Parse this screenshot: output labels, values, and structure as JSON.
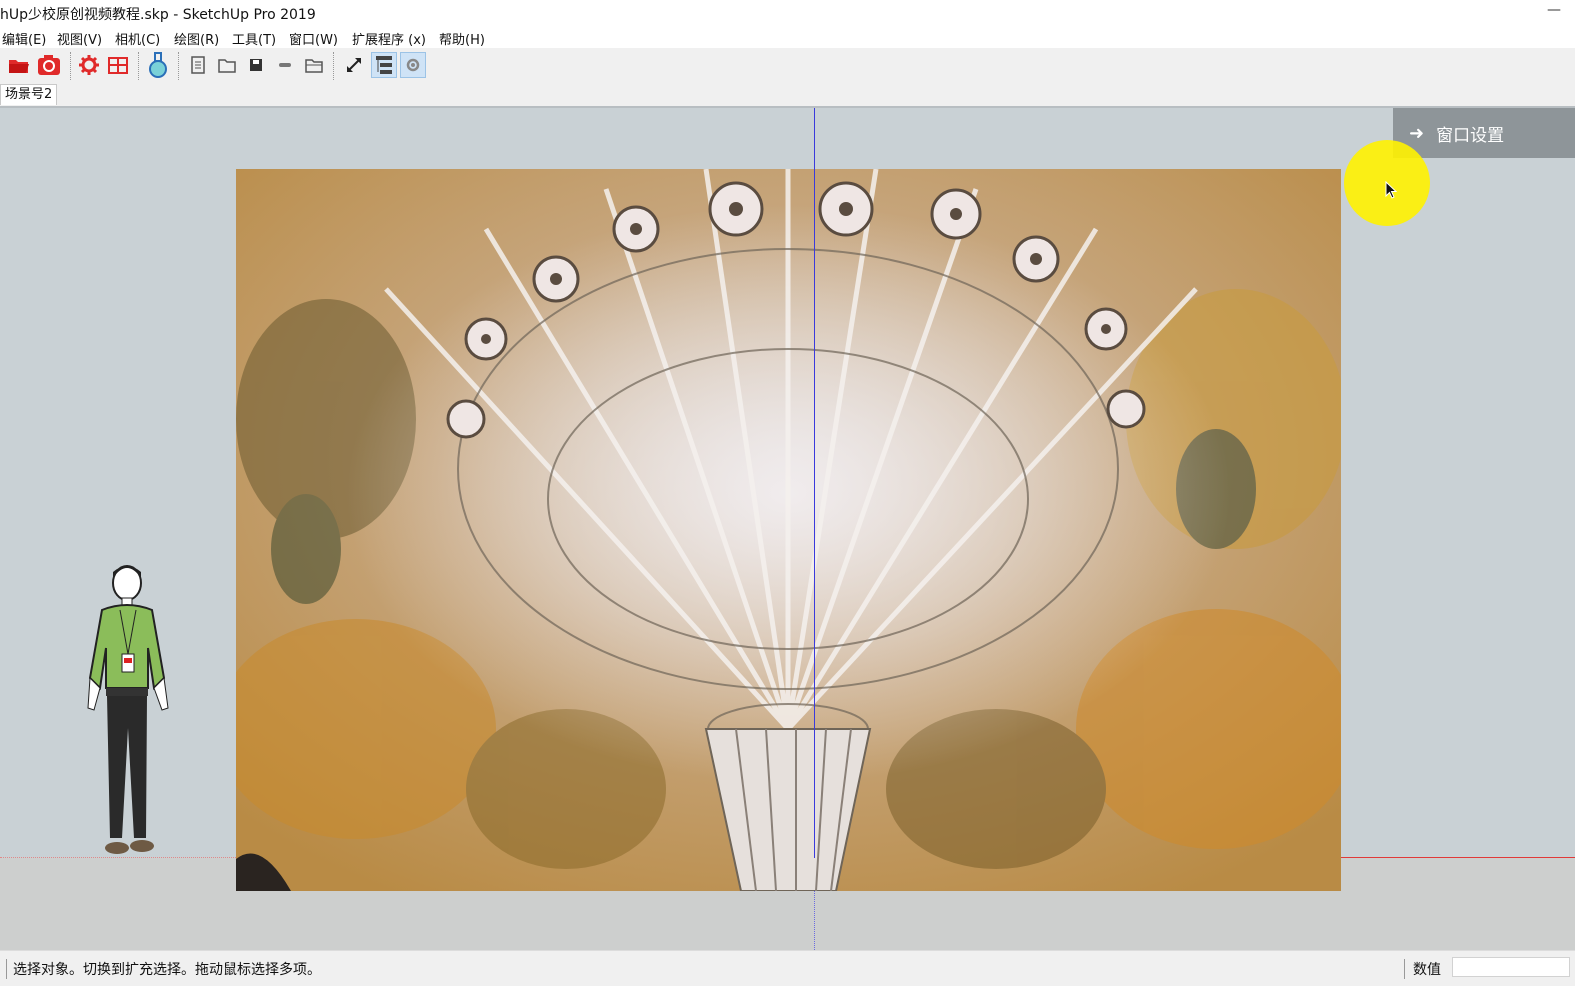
{
  "window": {
    "title": "hUp少校原创视频教程.skp - SketchUp Pro 2019",
    "minimize_glyph": "—"
  },
  "menu": [
    {
      "label": "编辑(E)"
    },
    {
      "label": "视图(V)"
    },
    {
      "label": "相机(C)"
    },
    {
      "label": "绘图(R)"
    },
    {
      "label": "工具(T)"
    },
    {
      "label": "窗口(W)"
    },
    {
      "label": "扩展程序 (x)"
    },
    {
      "label": "帮助(H)"
    }
  ],
  "toolbar": {
    "icons": [
      "open-folder-icon",
      "camera-icon",
      "gear-settings-icon",
      "grid-icon",
      "flask-icon",
      "document-icon",
      "folder-icon",
      "save-icon",
      "minus-icon",
      "folder-open-icon",
      "resize-icon",
      "outliner-icon",
      "cog-icon"
    ],
    "active_icon": "outliner-icon",
    "accent_red": "#e02a2a",
    "accent_blue": "#2a6fb8"
  },
  "scenes": {
    "tabs": [
      {
        "label": "场景号2"
      }
    ]
  },
  "overlay": {
    "window_settings_label": "窗口设置",
    "cursor_highlight_color": "#fff200"
  },
  "axes": {
    "red": "#e03a3a",
    "blue": "#3a3adc",
    "green_hidden": true
  },
  "status": {
    "message": "选择对象。切换到扩充选择。拖动鼠标选择多项。",
    "value_label": "数值",
    "value": ""
  }
}
